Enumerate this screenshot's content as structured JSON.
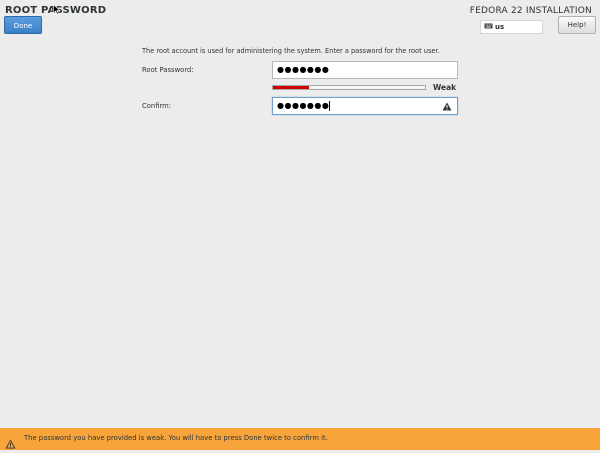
{
  "header": {
    "title": "ROOT PASSWORD",
    "done_label": "Done",
    "product": "FEDORA 22 INSTALLATION",
    "keyboard_layout": "us",
    "help_label": "Help!"
  },
  "form": {
    "description": "The root account is used for administering the system.  Enter a password for the root user.",
    "root_password_label": "Root Password:",
    "root_password_value": "●●●●●●●",
    "strength_label": "Weak",
    "strength_percent": 24,
    "confirm_label": "Confirm:",
    "confirm_value": "●●●●●●●"
  },
  "footer": {
    "message": "The password you have provided is weak. You will have to press Done twice to confirm it."
  },
  "colors": {
    "accent": "#3c7fc8",
    "warning_bar": "#f7a53a",
    "strength_weak": "#cc0000"
  },
  "icons": [
    "keyboard-icon",
    "warning-icon",
    "mouse-cursor-icon"
  ]
}
